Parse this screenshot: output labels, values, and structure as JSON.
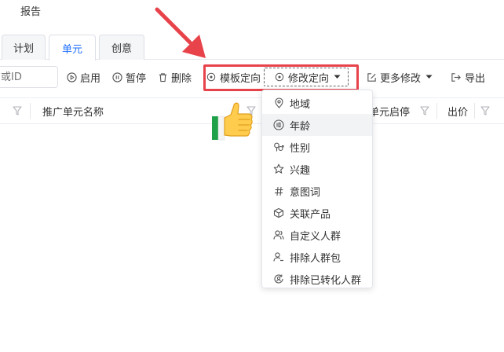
{
  "topnav": {
    "report": "报告"
  },
  "tabs": [
    {
      "label": "计划",
      "active": false
    },
    {
      "label": "单元",
      "active": true
    },
    {
      "label": "创意",
      "active": false
    }
  ],
  "toolbar": {
    "search_placeholder": "或ID",
    "enable": "启用",
    "pause": "暂停",
    "delete": "删除",
    "template_targeting": "模板定向",
    "modify_targeting": "修改定向",
    "more_modify": "更多修改",
    "export": "导出"
  },
  "table": {
    "columns": {
      "unit_name": "推广单元名称",
      "unit_status": "单元启停",
      "bid": "出价"
    }
  },
  "dropdown": {
    "items": [
      {
        "label": "地域",
        "icon": "location-pin-icon"
      },
      {
        "label": "年龄",
        "icon": "age-badge-icon"
      },
      {
        "label": "性别",
        "icon": "gender-icon"
      },
      {
        "label": "兴趣",
        "icon": "star-icon"
      },
      {
        "label": "意图词",
        "icon": "hash-icon"
      },
      {
        "label": "关联产品",
        "icon": "cube-icon"
      },
      {
        "label": "自定义人群",
        "icon": "user-group-icon"
      },
      {
        "label": "排除人群包",
        "icon": "user-minus-icon"
      },
      {
        "label": "排除已转化人群",
        "icon": "user-cycle-icon"
      }
    ]
  },
  "colors": {
    "accent": "#1e6fff",
    "highlight_border": "#e8424a",
    "hover_bg": "#f2f3f5"
  }
}
